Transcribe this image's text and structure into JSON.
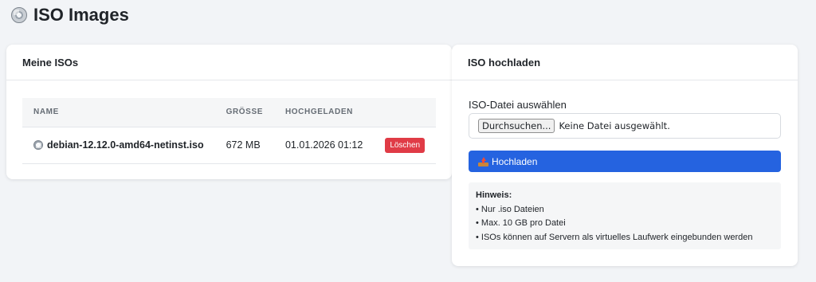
{
  "page": {
    "title": "ISO Images",
    "title_icon": "disc-icon"
  },
  "my_isos": {
    "title": "Meine ISOs",
    "columns": [
      "NAME",
      "GRÖSSE",
      "HOCHGELADEN"
    ],
    "rows": [
      {
        "icon": "disc-icon",
        "name": "debian-12.12.0-amd64-netinst.iso",
        "size": "672 MB",
        "uploaded": "01.01.2026 01:12",
        "delete_label": "Löschen"
      }
    ]
  },
  "upload": {
    "title": "ISO hochladen",
    "field_label": "ISO-Datei auswählen",
    "browse_label": "Durchsuchen...",
    "no_file_text": "Keine Datei ausgewählt.",
    "upload_button_label": "Hochladen",
    "upload_icon": "inbox-tray-icon",
    "hint": {
      "title": "Hinweis:",
      "items": [
        "• Nur .iso Dateien",
        "• Max. 10 GB pro Datei",
        "• ISOs können auf Servern als virtuelles Laufwerk eingebunden werden"
      ]
    }
  },
  "colors": {
    "primary": "#2563e0",
    "danger": "#e03b46",
    "page_background": "#f2f4f7"
  }
}
